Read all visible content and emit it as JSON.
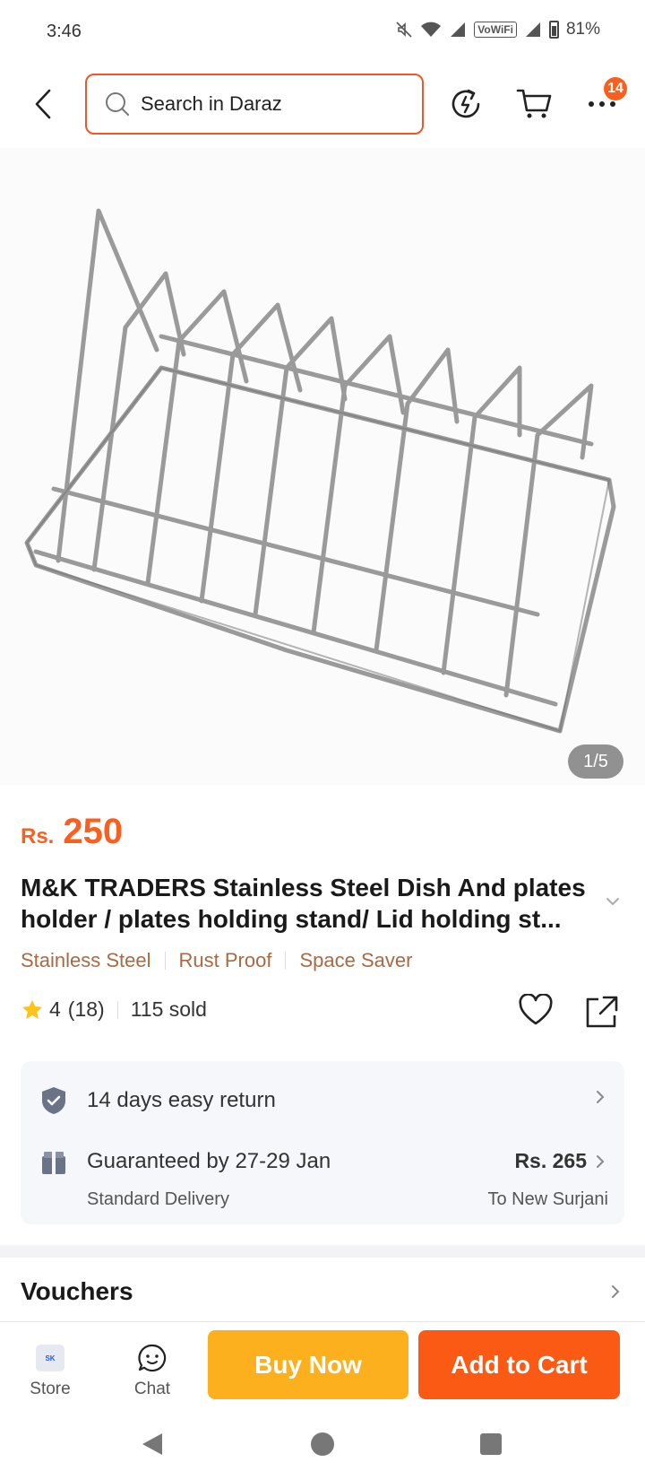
{
  "status_bar": {
    "time": "3:46",
    "network": "VoWiFi",
    "battery": "81%"
  },
  "header": {
    "search_placeholder": "Search in Daraz",
    "cart_badge": "14"
  },
  "gallery": {
    "counter": "1/5"
  },
  "product": {
    "currency": "Rs.",
    "price": "250",
    "title": "M&K TRADERS Stainless Steel Dish And plates holder / plates holding stand/ Lid holding st...",
    "tags": [
      "Stainless Steel",
      "Rust Proof",
      "Space Saver"
    ],
    "rating": "4",
    "reviews": "(18)",
    "sold": "115 sold"
  },
  "service": {
    "return_text": "14 days easy return",
    "delivery_title": "Guaranteed by 27-29 Jan",
    "delivery_sub": "Standard Delivery",
    "delivery_price": "Rs. 265",
    "delivery_to": "To New Surjani"
  },
  "vouchers": {
    "label": "Vouchers"
  },
  "action_bar": {
    "store_label": "Store",
    "store_logo": "SK",
    "chat_label": "Chat",
    "buy_label": "Buy Now",
    "cart_label": "Add to Cart"
  },
  "colors": {
    "accent": "#fa5f1e",
    "buy": "#fdb01e",
    "cart": "#fb5a14",
    "tag": "#a86a43"
  }
}
